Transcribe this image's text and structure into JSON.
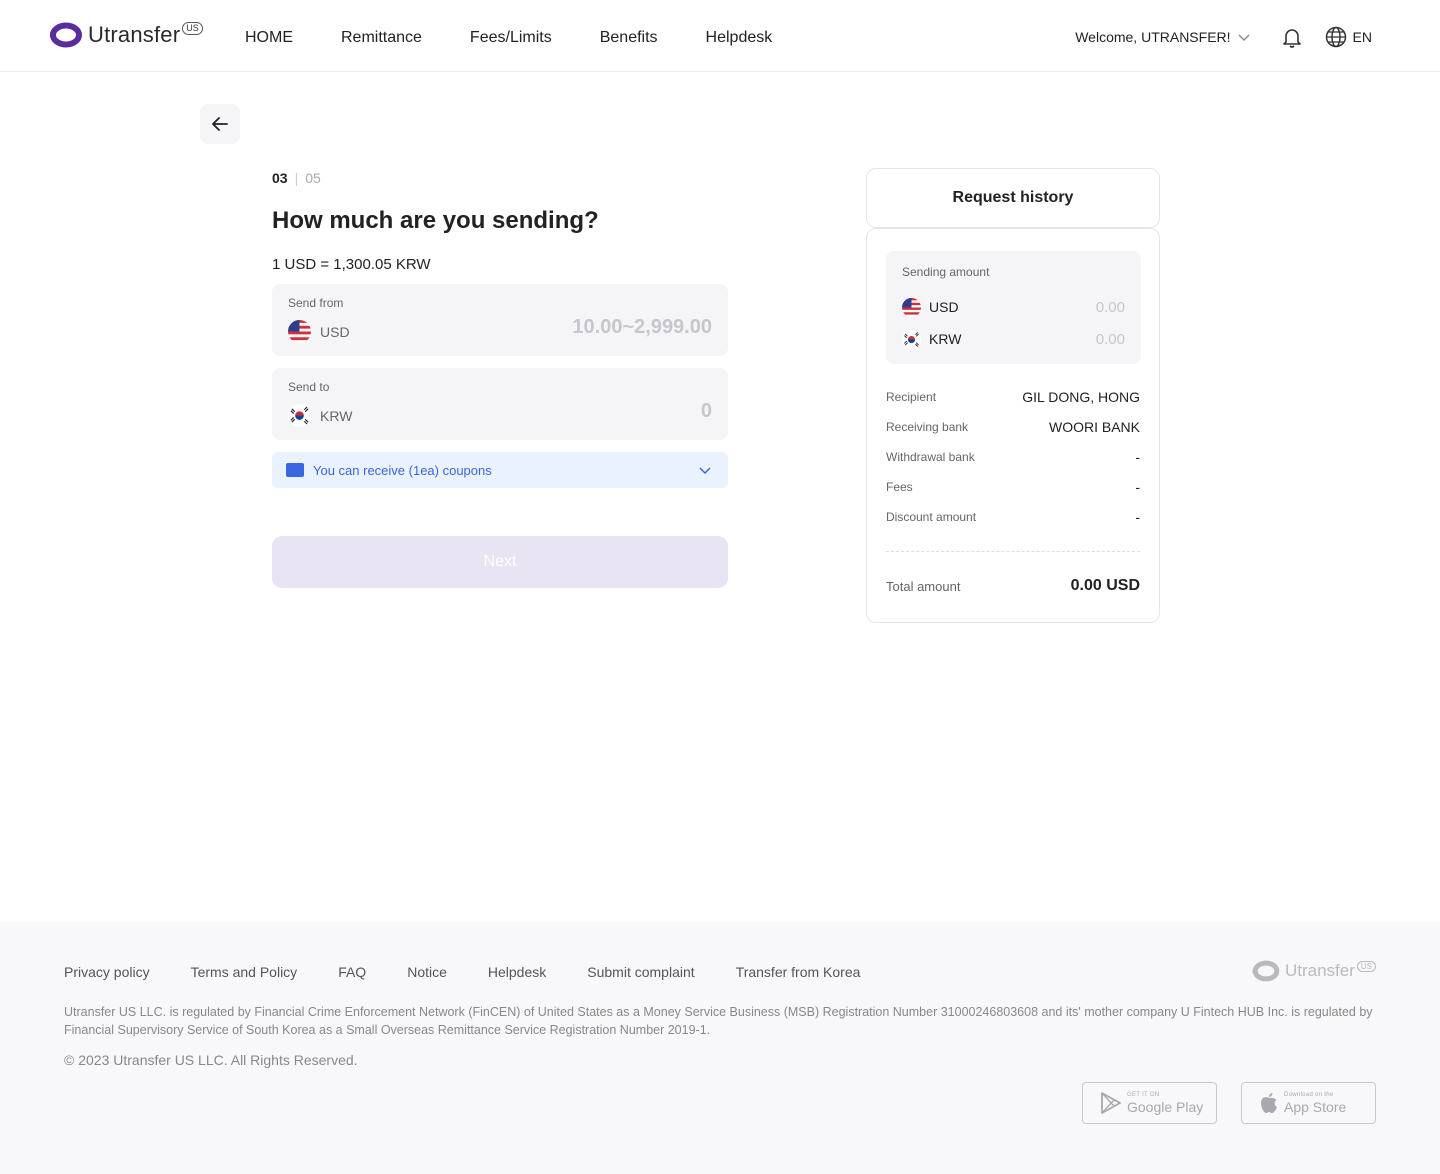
{
  "header": {
    "logo_text": "Utransfer",
    "logo_badge": "US",
    "nav": [
      "HOME",
      "Remittance",
      "Fees/Limits",
      "Benefits",
      "Helpdesk"
    ],
    "welcome": "Welcome, UTRANSFER!",
    "language": "EN"
  },
  "form": {
    "step_current": "03",
    "step_total": "05",
    "title": "How much are you sending?",
    "rate": "1 USD = 1,300.05 KRW",
    "send_from": {
      "label": "Send from",
      "currency": "USD",
      "placeholder": "10.00~2,999.00"
    },
    "send_to": {
      "label": "Send to",
      "currency": "KRW",
      "value": "0"
    },
    "coupon_text": "You can receive (1ea) coupons",
    "next_label": "Next"
  },
  "history": {
    "title": "Request history",
    "sending_label": "Sending amount",
    "sending": [
      {
        "currency": "USD",
        "value": "0.00"
      },
      {
        "currency": "KRW",
        "value": "0.00"
      }
    ],
    "rows": [
      {
        "key": "Recipient",
        "value": "GIL DONG, HONG"
      },
      {
        "key": "Receiving bank",
        "value": "WOORI BANK"
      },
      {
        "key": "Withdrawal bank",
        "value": "-"
      },
      {
        "key": "Fees",
        "value": "-"
      },
      {
        "key": "Discount amount",
        "value": "-"
      }
    ],
    "total_label": "Total amount",
    "total_value": "0.00 USD"
  },
  "footer": {
    "links": [
      "Privacy policy",
      "Terms and Policy",
      "FAQ",
      "Notice",
      "Helpdesk",
      "Submit complaint",
      "Transfer from Korea"
    ],
    "logo_text": "Utransfer",
    "logo_badge": "US",
    "legal": "Utransfer US LLC. is regulated by Financial Crime Enforcement Network (FinCEN) of United States as a Money Service Business (MSB) Registration Number 31000246803608 and its' mother company U Fintech HUB Inc. is regulated by Financial Supervisory Service of South Korea as a Small Overseas Remittance Service Registration Number 2019-1.",
    "copyright": "© 2023 Utransfer US LLC. All Rights Reserved.",
    "google_small": "GET IT ON",
    "google_big": "Google Play",
    "apple_small": "Download on the",
    "apple_big": "App Store"
  },
  "colors": {
    "brand": "#5b2ca0",
    "coupon_bg": "#eaf1ff",
    "coupon_text": "#3a66e0",
    "next_disabled": "#e8e4f3"
  },
  "icons": [
    "back-arrow-icon",
    "chevron-down-icon",
    "bell-icon",
    "globe-icon",
    "us-flag-icon",
    "kr-flag-icon",
    "coupon-icon",
    "google-play-icon",
    "apple-icon"
  ]
}
